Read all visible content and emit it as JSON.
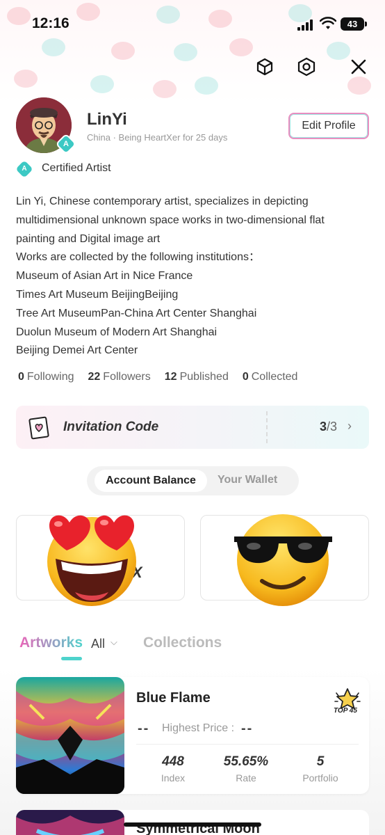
{
  "status_bar": {
    "time": "12:16",
    "battery": "43"
  },
  "icons": {
    "cube": "cube-icon",
    "settings": "hexagon-settings-icon",
    "close": "close-icon"
  },
  "profile": {
    "name": "LinYi",
    "subline": "China · Being HeartXer for 25 days",
    "edit_label": "Edit Profile",
    "certified_label": "Certified Artist",
    "badge_letter": "A"
  },
  "bio": [
    "Lin Yi, Chinese contemporary artist, specializes in depicting",
    "multidimensional unknown space works in two-dimensional flat",
    "painting and Digital image art",
    "Works are collected by the following institutions：",
    "Museum of Asian Art in Nice France",
    "Times Art Museum BeijingBeijing",
    "Tree Art MuseumPan-China Art Center Shanghai",
    "Duolun Museum of Modern Art Shanghai",
    "Beijing Demei Art Center"
  ],
  "stats": [
    {
      "value": "0",
      "label": "Following"
    },
    {
      "value": "22",
      "label": "Followers"
    },
    {
      "value": "12",
      "label": "Published"
    },
    {
      "value": "0",
      "label": "Collected"
    }
  ],
  "invitation": {
    "label": "Invitation Code",
    "used": "3",
    "total": "/3"
  },
  "balance_tabs": {
    "active": "Account Balance",
    "inactive": "Your Wallet"
  },
  "cards": {
    "left_text": "NX"
  },
  "content_tabs": {
    "artworks": "Artworks",
    "filter": "All",
    "collections": "Collections"
  },
  "artworks": [
    {
      "title": "Blue Flame",
      "price_dash": "--",
      "price_label": "Highest Price :",
      "price_value": "--",
      "badge": "TOP 45",
      "metrics": [
        {
          "value": "448",
          "label": "Index"
        },
        {
          "value": "55.65%",
          "label": "Rate"
        },
        {
          "value": "5",
          "label": "Portfolio"
        }
      ]
    },
    {
      "title": "Symmetrical Moon"
    }
  ],
  "colors": {
    "accent_teal": "#3cc9c4",
    "accent_pink": "#e965b8"
  }
}
